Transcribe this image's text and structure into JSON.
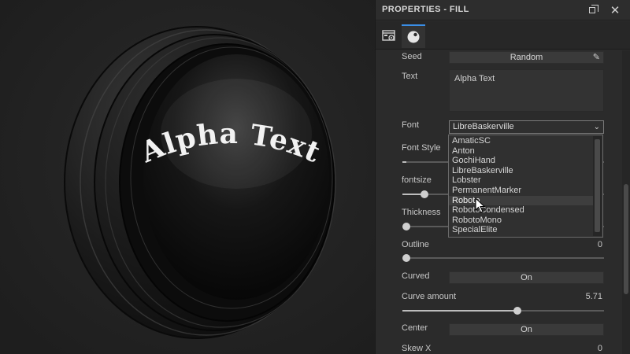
{
  "viewport": {
    "preview_text": "Alpha Text",
    "preview_text_color": "#f2f2f2",
    "button_color": "#101010"
  },
  "panel": {
    "title": "PROPERTIES - FILL",
    "restore_icon": "restore-window-icon",
    "close_icon": "close-icon",
    "tabs": [
      {
        "icon": "scene-settings-icon",
        "active": false
      },
      {
        "icon": "material-sphere-icon",
        "active": true
      }
    ],
    "accent_color": "#3a8ee6"
  },
  "props": {
    "seed": {
      "label": "Seed",
      "button_label": "Random",
      "icon": "pencil-icon"
    },
    "text": {
      "label": "Text",
      "value": "Alpha Text"
    },
    "font": {
      "label": "Font",
      "selected": "LibreBaskerville",
      "options": [
        "AmaticSC",
        "Anton",
        "GochiHand",
        "LibreBaskerville",
        "Lobster",
        "PermanentMarker",
        "Roboto",
        "RobotoCondensed",
        "RobotoMono",
        "SpecialElite"
      ],
      "hovered_index": 6
    },
    "font_style": {
      "label": "Font Style",
      "level": 0.02
    },
    "fontsize": {
      "label": "fontsize",
      "level": 0.11
    },
    "thickness": {
      "label": "Thickness",
      "level": 0.0
    },
    "outline": {
      "label": "Outline",
      "value": "0",
      "level": 0.0
    },
    "curved": {
      "label": "Curved",
      "toggle": "On"
    },
    "curve_amount": {
      "label": "Curve amount",
      "value": "5.71",
      "level": 0.57
    },
    "center": {
      "label": "Center",
      "toggle": "On"
    },
    "skew_x": {
      "label": "Skew X",
      "value": "0"
    }
  }
}
